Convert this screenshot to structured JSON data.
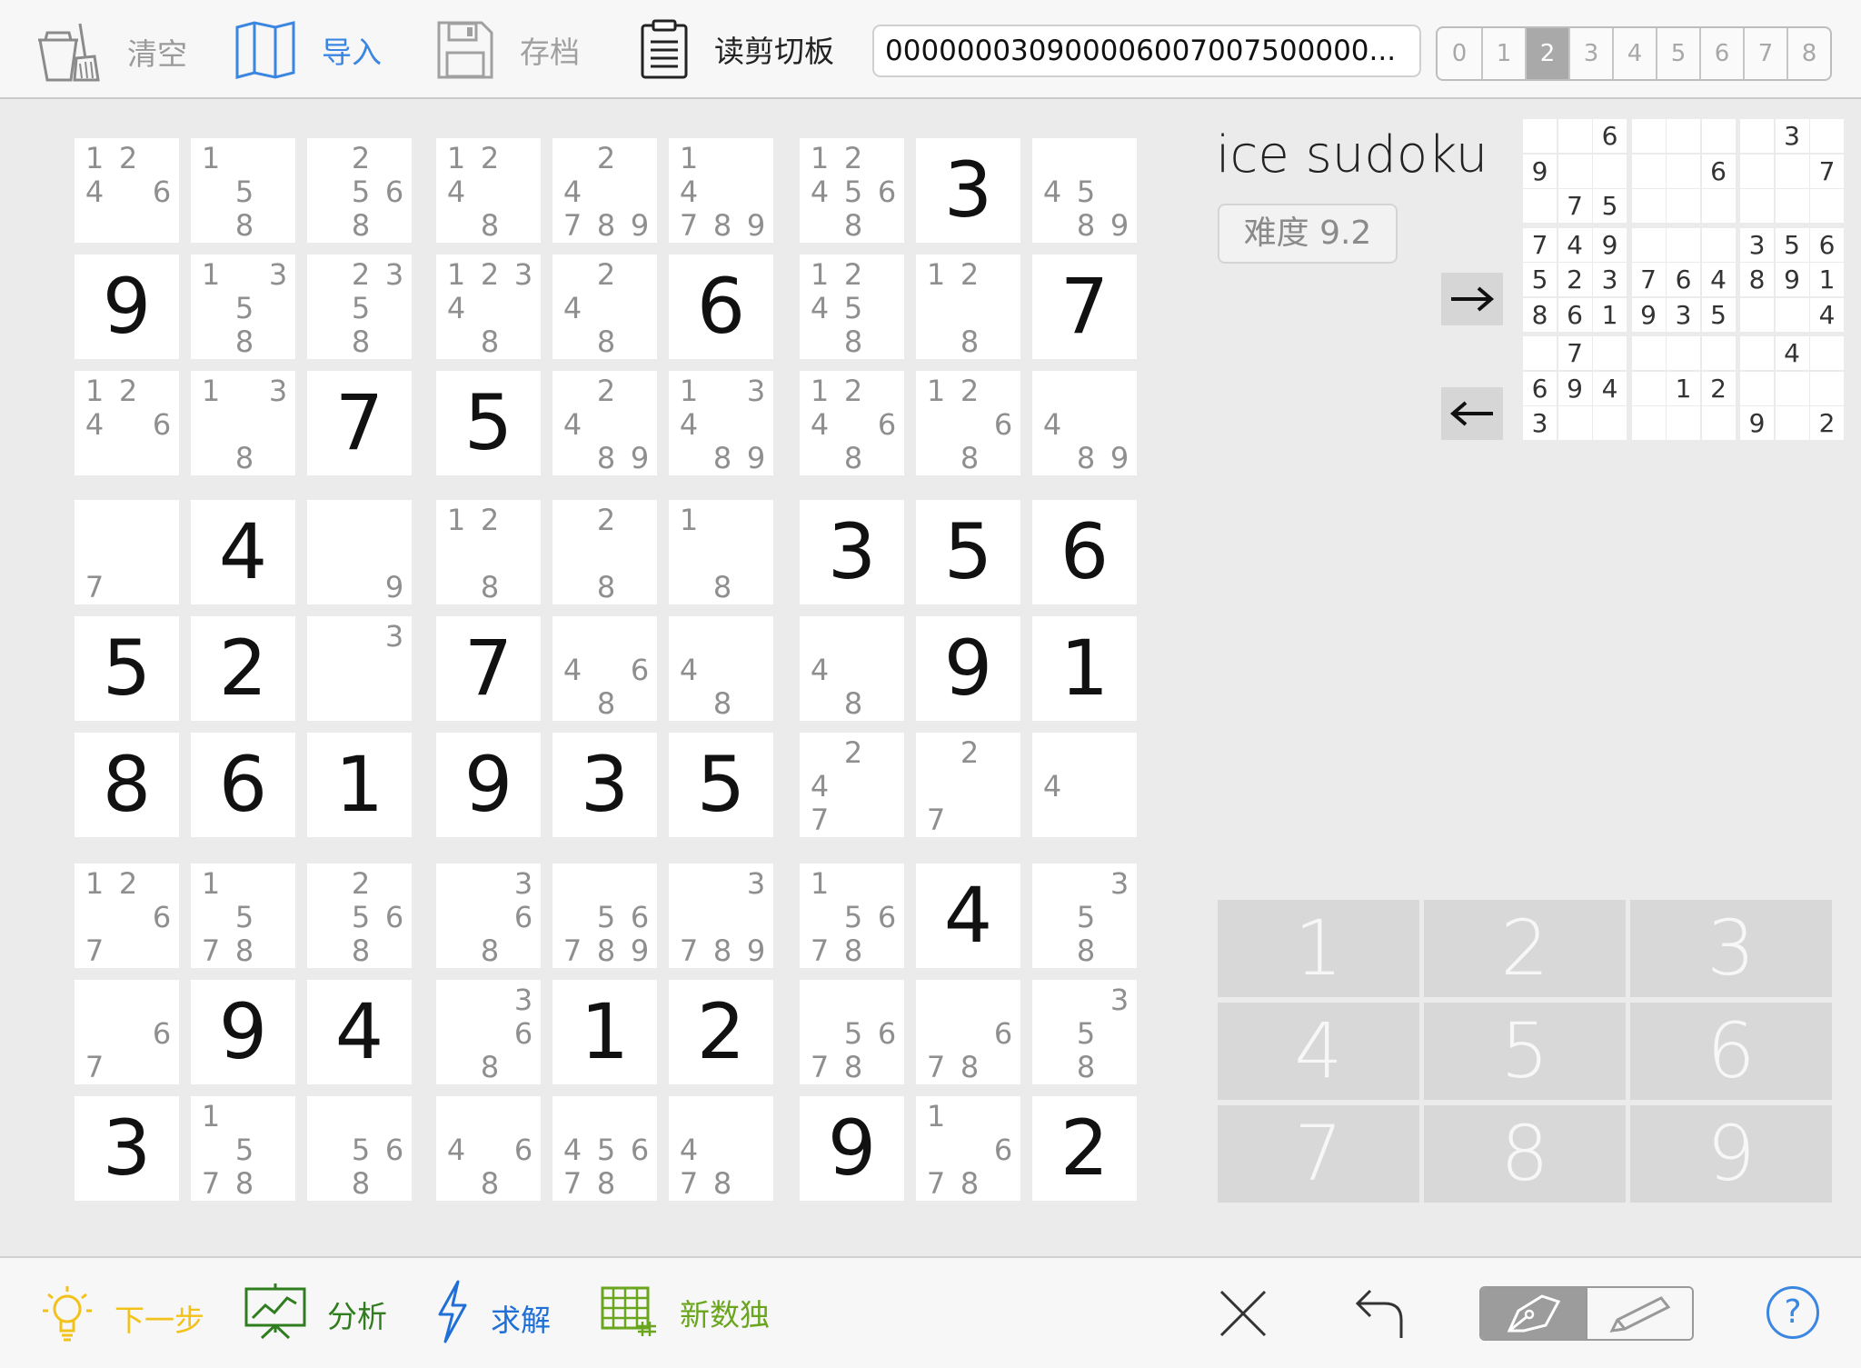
{
  "toolbar": {
    "clear_label": "清空",
    "import_label": "导入",
    "save_label": "存档",
    "clipboard_label": "读剪切板",
    "clipboard_value": "000000030900006007007500000...",
    "digit_tabs": [
      "0",
      "1",
      "2",
      "3",
      "4",
      "5",
      "6",
      "7",
      "8"
    ],
    "active_digit_tab": "2"
  },
  "board": {
    "givens": [
      [
        0,
        0,
        0,
        0,
        0,
        0,
        0,
        3,
        0
      ],
      [
        9,
        0,
        0,
        0,
        0,
        6,
        0,
        0,
        7
      ],
      [
        0,
        0,
        7,
        5,
        0,
        0,
        0,
        0,
        0
      ],
      [
        0,
        4,
        0,
        0,
        0,
        0,
        3,
        5,
        6
      ],
      [
        5,
        2,
        0,
        7,
        0,
        0,
        0,
        9,
        1
      ],
      [
        8,
        6,
        1,
        9,
        3,
        5,
        0,
        0,
        0
      ],
      [
        0,
        0,
        0,
        0,
        0,
        0,
        0,
        4,
        0
      ],
      [
        0,
        9,
        4,
        0,
        1,
        2,
        0,
        0,
        0
      ],
      [
        3,
        0,
        0,
        0,
        0,
        0,
        9,
        0,
        2
      ]
    ],
    "candidates": [
      [
        "1246",
        "158",
        "2568",
        "1248",
        "24789",
        "14789",
        "124568",
        "",
        "4589"
      ],
      [
        "",
        "1358",
        "23358",
        "1234 8",
        "248",
        "",
        "12458",
        "128",
        ""
      ],
      [
        "1246",
        "138",
        "",
        "",
        "2489",
        "13489",
        "12468",
        "1268",
        "489"
      ],
      [
        "7",
        "",
        "9",
        "128",
        "28",
        "18",
        "",
        "",
        ""
      ],
      [
        "",
        "",
        "3",
        "",
        "468",
        "48",
        "48",
        "",
        ""
      ],
      [
        "",
        "",
        "",
        "",
        "",
        "",
        "247",
        "27",
        "4"
      ],
      [
        "1267",
        "1578",
        "2568",
        "368",
        "56789",
        "3789",
        "15678",
        "",
        "358"
      ],
      [
        "67",
        "",
        "",
        "368",
        "",
        "",
        "5678",
        "678",
        "358"
      ],
      [
        "",
        "1578",
        "568",
        "468",
        "45678",
        "478",
        "",
        "1678",
        ""
      ]
    ]
  },
  "side": {
    "title": "ice sudoku",
    "difficulty": "难度 9.2",
    "next_arrow": "→",
    "prev_arrow": "←",
    "mini_grid": [
      [
        "",
        "",
        "6",
        "",
        "",
        "",
        "",
        "3",
        ""
      ],
      [
        "9",
        "",
        "",
        "",
        "",
        "6",
        "",
        "",
        "7"
      ],
      [
        "",
        "7",
        "5",
        "",
        "",
        "",
        "",
        "",
        ""
      ],
      [
        "7",
        "4",
        "9",
        "",
        "",
        "",
        "3",
        "5",
        "6"
      ],
      [
        "5",
        "2",
        "3",
        "7",
        "6",
        "4",
        "8",
        "9",
        "1"
      ],
      [
        "8",
        "6",
        "1",
        "9",
        "3",
        "5",
        "",
        "",
        "4"
      ],
      [
        "",
        "7",
        "",
        "",
        "",
        "",
        "",
        "4",
        ""
      ],
      [
        "6",
        "9",
        "4",
        "",
        "1",
        "2",
        "",
        "",
        ""
      ],
      [
        "3",
        "",
        "",
        "",
        "",
        "",
        "9",
        "",
        "2"
      ]
    ]
  },
  "keypad": [
    "1",
    "2",
    "3",
    "4",
    "5",
    "6",
    "7",
    "8",
    "9"
  ],
  "bottombar": {
    "hint_label": "下一步",
    "analyze_label": "分析",
    "solve_label": "求解",
    "new_label": "新数独",
    "help_label": "?"
  },
  "colors": {
    "hint": "#f2c21b",
    "analyze": "#2f7d1f",
    "solve": "#1f6fd6",
    "new": "#6aa51e",
    "import": "#3a86e0"
  }
}
